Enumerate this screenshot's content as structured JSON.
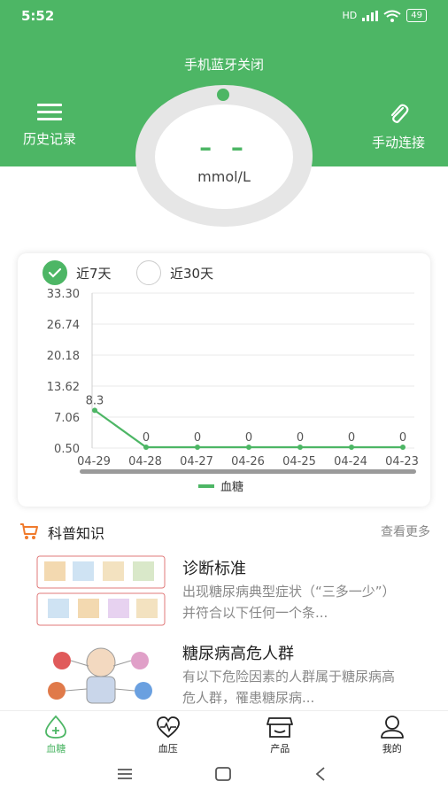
{
  "status": {
    "time": "5:52",
    "network": "HD",
    "battery": "49"
  },
  "header": {
    "bluetooth_status": "手机蓝牙关闭",
    "history_label": "历史记录",
    "manual_label": "手动连接",
    "reading_value": "– –",
    "reading_unit": "mmol/L"
  },
  "chart": {
    "range_options": [
      "近7天",
      "近30天"
    ],
    "selected_range": "近7天",
    "legend": "血糖",
    "accent": "#4db665"
  },
  "chart_data": {
    "type": "line",
    "categories": [
      "04-29",
      "04-28",
      "04-27",
      "04-26",
      "04-25",
      "04-24",
      "04-23"
    ],
    "series": [
      {
        "name": "血糖",
        "values": [
          8.3,
          0,
          0,
          0,
          0,
          0,
          0
        ]
      }
    ],
    "y_ticks": [
      "33.30",
      "26.74",
      "20.18",
      "13.62",
      "7.06",
      "0.50"
    ],
    "ylim": [
      0.5,
      33.3
    ],
    "legend_position": "bottom"
  },
  "science": {
    "title": "科普知识",
    "more": "查看更多",
    "articles": [
      {
        "title": "诊断标准",
        "desc": "出现糖尿病典型症状（“三多一少”）并符合以下任何一个条..."
      },
      {
        "title": "糖尿病高危人群",
        "desc": "有以下危险因素的人群属于糖尿病高危人群，罹患糖尿病..."
      }
    ]
  },
  "tabs": [
    {
      "label": "血糖",
      "icon": "drop-plus-icon",
      "active": true
    },
    {
      "label": "血压",
      "icon": "heart-pulse-icon",
      "active": false
    },
    {
      "label": "产品",
      "icon": "store-icon",
      "active": false
    },
    {
      "label": "我的",
      "icon": "person-icon",
      "active": false
    }
  ]
}
